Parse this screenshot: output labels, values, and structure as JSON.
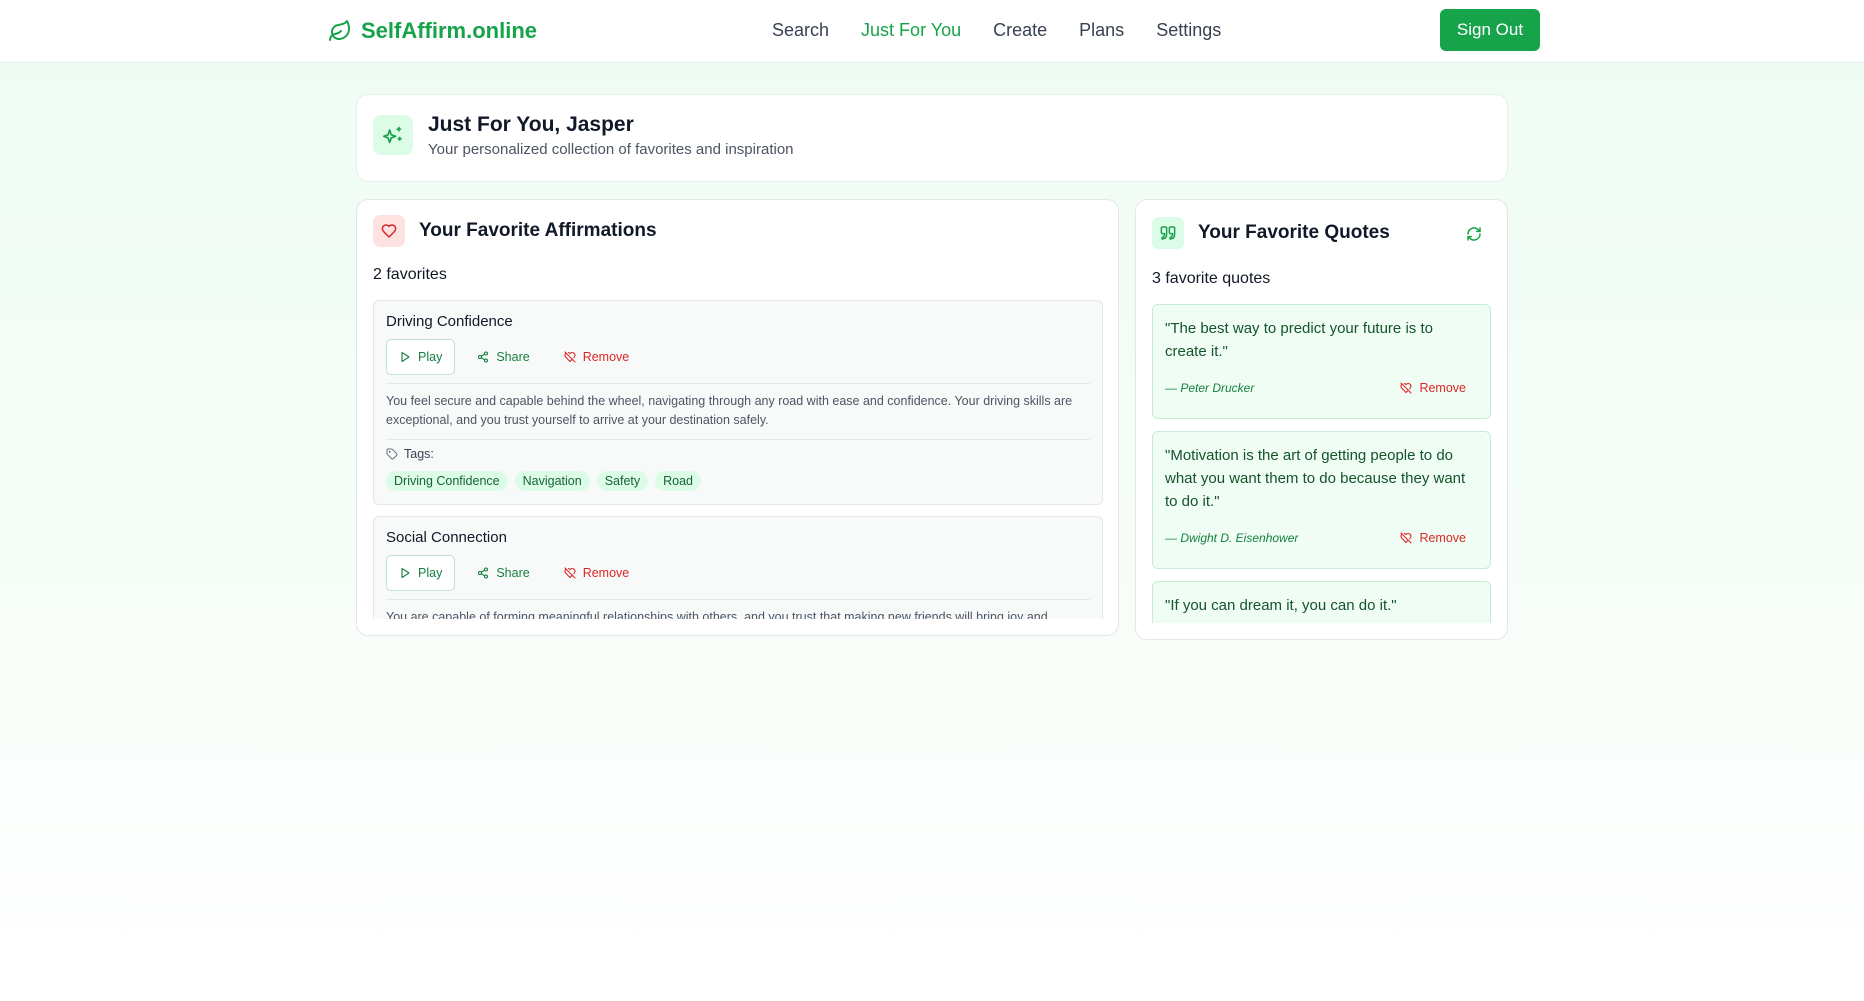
{
  "header": {
    "brand": "SelfAffirm.online",
    "nav": [
      "Search",
      "Just For You",
      "Create",
      "Plans",
      "Settings"
    ],
    "active_nav": "Just For You",
    "sign_out": "Sign Out"
  },
  "welcome": {
    "title": "Just For You, Jasper",
    "subtitle": "Your personalized collection of favorites and inspiration"
  },
  "affirmations": {
    "title": "Your Favorite Affirmations",
    "count": "2 favorites",
    "play_label": "Play",
    "share_label": "Share",
    "remove_label": "Remove",
    "tags_label": "Tags:",
    "items": [
      {
        "title": "Driving Confidence",
        "body": "You feel secure and capable behind the wheel, navigating through any road with ease and confidence. Your driving skills are exceptional, and you trust yourself to arrive at your destination safely.",
        "tags": [
          "Driving Confidence",
          "Navigation",
          "Safety",
          "Road"
        ]
      },
      {
        "title": "Social Connection",
        "body": "You are capable of forming meaningful relationships with others, and you trust that making new friends will bring joy and"
      }
    ]
  },
  "quotes": {
    "title": "Your Favorite Quotes",
    "count": "3 favorite quotes",
    "remove_label": "Remove",
    "items": [
      {
        "text": "\"The best way to predict your future is to create it.\"",
        "author": "— Peter Drucker"
      },
      {
        "text": "\"Motivation is the art of getting people to do what you want them to do because they want to do it.\"",
        "author": "— Dwight D. Eisenhower"
      },
      {
        "text": "\"If you can dream it, you can do it.\"",
        "author": ""
      }
    ]
  },
  "colors": {
    "accent": "#16a34a",
    "danger": "#dc2626",
    "tag_bg": "#dcfce7"
  }
}
